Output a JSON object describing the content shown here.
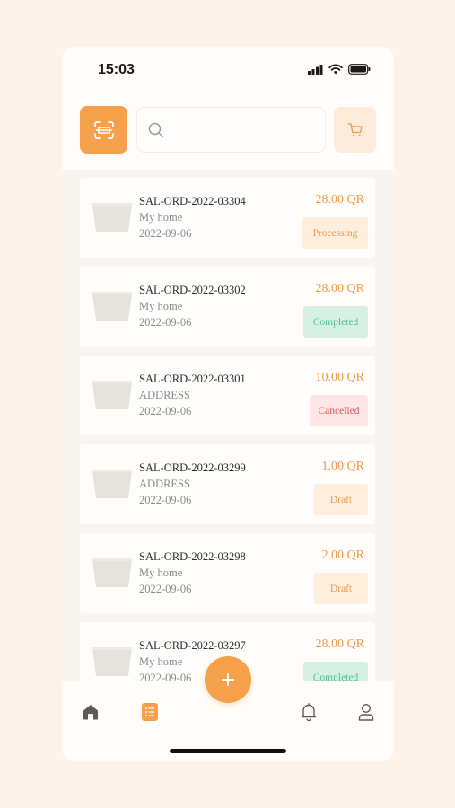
{
  "status_bar": {
    "time": "15:03"
  },
  "search": {
    "placeholder": ""
  },
  "orders": [
    {
      "id": "SAL-ORD-2022-03304",
      "address": "My home",
      "date": "2022-09-06",
      "price": "28.00 QR",
      "status": "Processing",
      "status_color": "#eb9a47"
    },
    {
      "id": "SAL-ORD-2022-03302",
      "address": "My home",
      "date": "2022-09-06",
      "price": "28.00 QR",
      "status": "Completed",
      "status_color": "#4ec196"
    },
    {
      "id": "SAL-ORD-2022-03301",
      "address": "ADDRESS",
      "date": "2022-09-06",
      "price": "10.00 QR",
      "status": "Cancelled",
      "status_color": "#e0595a"
    },
    {
      "id": "SAL-ORD-2022-03299",
      "address": "ADDRESS",
      "date": "2022-09-06",
      "price": "1.00 QR",
      "status": "Draft",
      "status_color": "#e39e5c"
    },
    {
      "id": "SAL-ORD-2022-03298",
      "address": "My home",
      "date": "2022-09-06",
      "price": "2.00 QR",
      "status": "Draft",
      "status_color": "#e39e5c"
    },
    {
      "id": "SAL-ORD-2022-03297",
      "address": "My home",
      "date": "2022-09-06",
      "price": "28.00 QR",
      "status": "Completed",
      "status_color": "#4ec196"
    }
  ],
  "nav": {
    "items": [
      {
        "icon": "home-icon"
      },
      {
        "icon": "orders-icon",
        "active": true
      },
      {
        "icon": "bell-icon"
      },
      {
        "icon": "profile-icon"
      }
    ],
    "fab_label": "+"
  },
  "colors": {
    "accent": "#f5a04a",
    "background": "#fdf3ea"
  }
}
